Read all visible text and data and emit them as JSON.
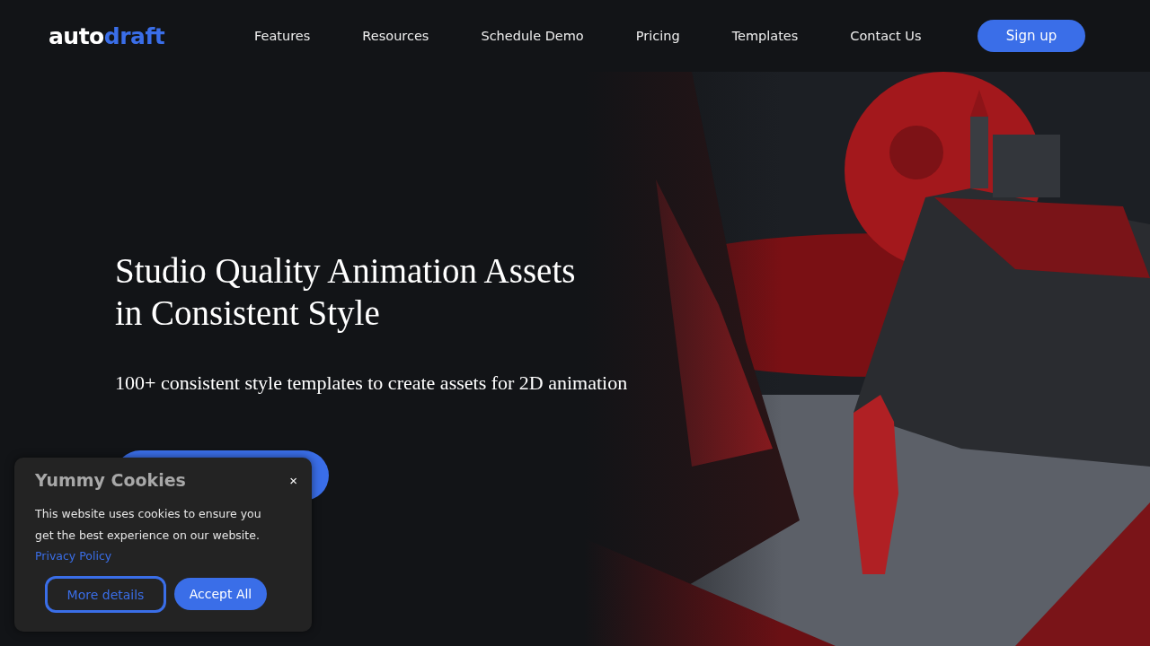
{
  "header": {
    "logo": {
      "first": "auto",
      "second": "draft"
    },
    "nav": [
      {
        "label": "Features"
      },
      {
        "label": "Resources"
      },
      {
        "label": "Schedule Demo"
      },
      {
        "label": "Pricing"
      },
      {
        "label": "Templates"
      },
      {
        "label": "Contact Us"
      }
    ],
    "signup": "Sign up"
  },
  "hero": {
    "title_lines": [
      "Studio Quality Animation Assets",
      "in Consistent Style"
    ],
    "subtitle": "100+ consistent style templates to create assets for 2D animation"
  },
  "cookie_banner": {
    "title": "Yummy Cookies",
    "close": "×",
    "text": "This website uses cookies to ensure you get the best experience on our website.",
    "link": "Privacy Policy",
    "buttons": [
      {
        "label": "More details",
        "kind": "outline"
      },
      {
        "label": "Accept All",
        "kind": "primary"
      }
    ]
  }
}
